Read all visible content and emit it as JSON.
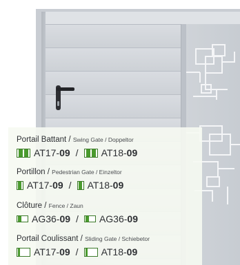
{
  "colors": {
    "accent_green": "#4a9a2e",
    "text": "#2d2f33",
    "overlay_bg": "#f6f9f2",
    "gate_grey": "#cfd3d8"
  },
  "handle_icon": "door-handle-icon",
  "categories": [
    {
      "title": "Portail Battant",
      "subtitle": "Swing Gate / Doppeltor",
      "icon": "double-leaf-gate-icon",
      "codes": [
        {
          "prefix": "AT17-",
          "suffix": "09"
        },
        {
          "prefix": "AT18-",
          "suffix": "09"
        }
      ]
    },
    {
      "title": "Portillon",
      "subtitle": "Pedestrian Gate / Einzeltor",
      "icon": "single-leaf-gate-icon",
      "codes": [
        {
          "prefix": "AT17-",
          "suffix": "09"
        },
        {
          "prefix": "AT18-",
          "suffix": "09"
        }
      ]
    },
    {
      "title": "Clôture",
      "subtitle": "Fence / Zaun",
      "icon": "fence-panel-icon",
      "codes": [
        {
          "prefix": "AG36-",
          "suffix": "09"
        },
        {
          "prefix": "AG36-",
          "suffix": "09"
        }
      ]
    },
    {
      "title": "Portail Coulissant",
      "subtitle": "Sliding Gate / Schiebetor",
      "icon": "sliding-gate-icon",
      "codes": [
        {
          "prefix": "AT17-",
          "suffix": "09"
        },
        {
          "prefix": "AT18-",
          "suffix": "09"
        }
      ]
    }
  ],
  "slash": "/"
}
